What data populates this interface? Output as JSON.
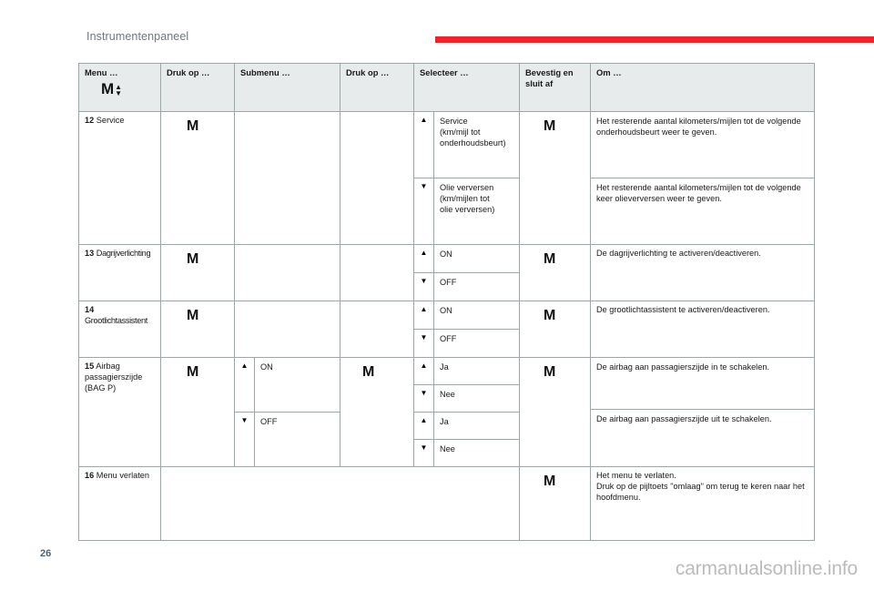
{
  "header": {
    "chapter_title": "Instrumentenpaneel",
    "rule_color": "#fb1f25"
  },
  "table": {
    "columns": [
      {
        "label": "Menu …",
        "key_glyph": "M",
        "has_updown_arrows": true
      },
      {
        "label": "Druk op …"
      },
      {
        "label": "Submenu …"
      },
      {
        "label": "Druk op …"
      },
      {
        "label": "Selecteer …"
      },
      {
        "label": "Bevestig en sluit af"
      },
      {
        "label": "Om …"
      }
    ],
    "rows": [
      {
        "index": "12",
        "name": "Service",
        "press1": "M",
        "submenu": [],
        "press2": "",
        "select": [
          {
            "arrow": "▲",
            "text": "Service\n(km/mijl tot\nonderhoudsbeurt)"
          },
          {
            "arrow": "▼",
            "text": "Olie verversen\n(km/mijlen tot\nolie verversen)"
          }
        ],
        "confirm": "M",
        "about": [
          "Het resterende aantal kilometers/mijlen tot de volgende onderhoudsbeurt weer te geven.",
          "Het resterende aantal kilometers/mijlen tot de volgende keer olieverversen weer te geven."
        ]
      },
      {
        "index": "13",
        "name": "Dagrijverlichting",
        "press1": "M",
        "select": [
          {
            "arrow": "▲",
            "text": "ON"
          },
          {
            "arrow": "▼",
            "text": "OFF"
          }
        ],
        "confirm": "M",
        "about": [
          "De dagrijverlichting te activeren/deactiveren."
        ]
      },
      {
        "index": "14",
        "name": "Grootlichtassistent",
        "press1": "M",
        "select": [
          {
            "arrow": "▲",
            "text": "ON"
          },
          {
            "arrow": "▼",
            "text": "OFF"
          }
        ],
        "confirm": "M",
        "about": [
          "De grootlichtassistent te activeren/deactiveren."
        ]
      },
      {
        "index": "15",
        "name": "Airbag passagierszijde (BAG P)",
        "press1": "M",
        "submenu": [
          {
            "arrow": "▲",
            "text": "ON"
          },
          {
            "arrow": "▼",
            "text": "OFF"
          }
        ],
        "press2": "M",
        "select": [
          {
            "arrow": "▲",
            "text": "Ja"
          },
          {
            "arrow": "▼",
            "text": "Nee"
          },
          {
            "arrow": "▲",
            "text": "Ja"
          },
          {
            "arrow": "▼",
            "text": "Nee"
          }
        ],
        "confirm": "M",
        "about": [
          "De airbag aan passagierszijde in te schakelen.",
          "De airbag aan passagierszijde uit te schakelen."
        ]
      },
      {
        "index": "16",
        "name": "Menu verlaten",
        "press1": "",
        "confirm": "M",
        "about": [
          "Het menu te verlaten.\nDruk op de pijltoets \"omlaag\" om terug te keren naar het hoofdmenu."
        ]
      }
    ]
  },
  "footer": {
    "page_number": "26",
    "watermark": "carmanualsonline.info"
  }
}
